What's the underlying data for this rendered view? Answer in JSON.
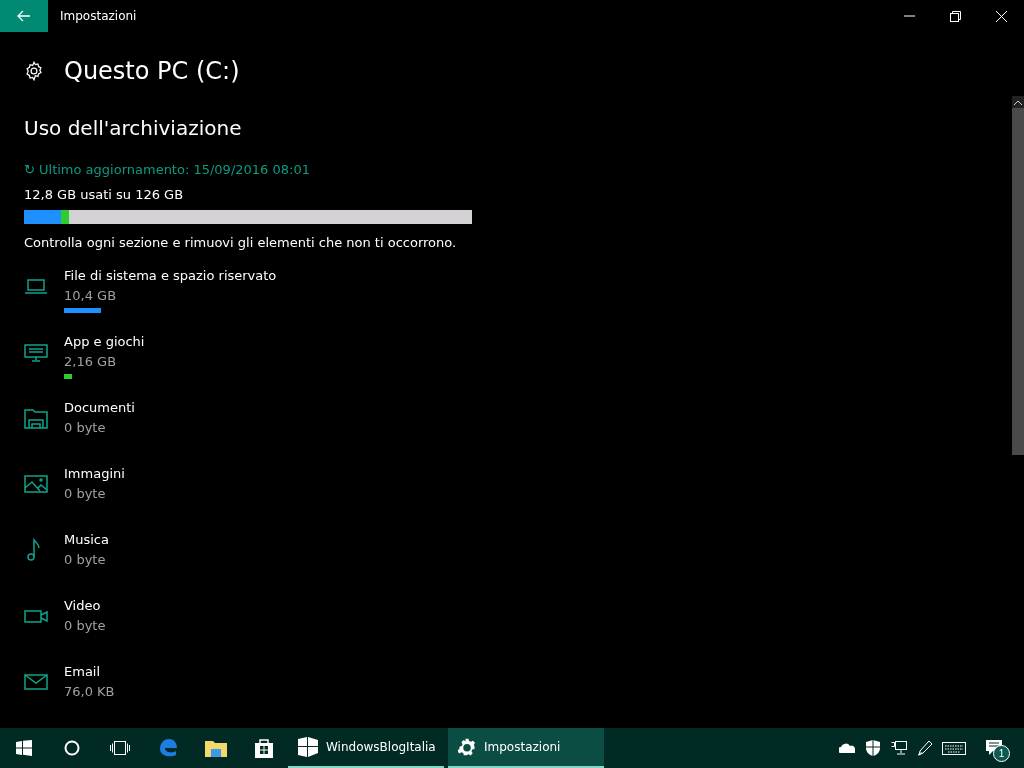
{
  "window": {
    "title": "Impostazioni"
  },
  "page": {
    "title": "Questo PC (C:)"
  },
  "section": {
    "title": "Uso dell'archiviazione",
    "updated": "↻ Ultimo aggiornamento: 15/09/2016 08:01",
    "usage": "12,8 GB usati su 126 GB",
    "hint": "Controlla ogni sezione e rimuovi gli elementi che non ti occorrono."
  },
  "items": [
    {
      "kind": "system",
      "name": "File di sistema e spazio riservato",
      "size": "10,4 GB",
      "level": 0.083,
      "color": "#1e90ff"
    },
    {
      "kind": "apps",
      "name": "App e giochi",
      "size": "2,16 GB",
      "level": 0.017,
      "color": "#2ecc2e"
    },
    {
      "kind": "documents",
      "name": "Documenti",
      "size": "0 byte"
    },
    {
      "kind": "pictures",
      "name": "Immagini",
      "size": "0 byte"
    },
    {
      "kind": "music",
      "name": "Musica",
      "size": "0 byte"
    },
    {
      "kind": "video",
      "name": "Video",
      "size": "0 byte"
    },
    {
      "kind": "mail",
      "name": "Email",
      "size": "76,0 KB"
    }
  ],
  "taskbar": {
    "apps": [
      {
        "kind": "blog",
        "label": "WindowsBlogItalia",
        "selected": false
      },
      {
        "kind": "settings",
        "label": "Impostazioni",
        "selected": true
      }
    ],
    "notification_count": "1"
  }
}
